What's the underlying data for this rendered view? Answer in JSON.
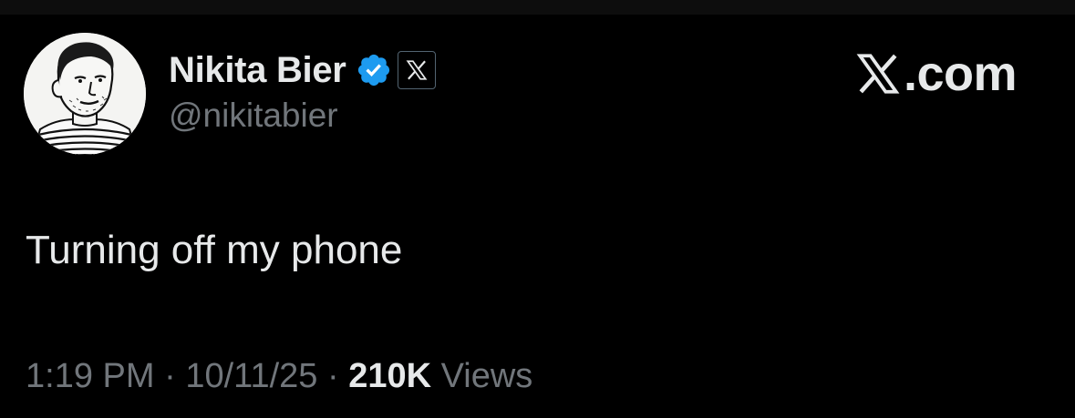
{
  "author": {
    "display_name": "Nikita Bier",
    "handle": "@nikitabier",
    "verified": true,
    "affiliate_badge_icon": "x-logo-icon",
    "verified_color": "#1d9bf0"
  },
  "watermark": {
    "logo_icon": "x-logo-icon",
    "text": ".com"
  },
  "tweet": {
    "text": "Turning off my phone"
  },
  "meta": {
    "time": "1:19 PM",
    "separator": " · ",
    "date": "10/11/25",
    "views_count": "210K",
    "views_label": " Views"
  },
  "colors": {
    "background": "#000000",
    "primary_text": "#e7e9ea",
    "secondary_text": "#71767b"
  }
}
